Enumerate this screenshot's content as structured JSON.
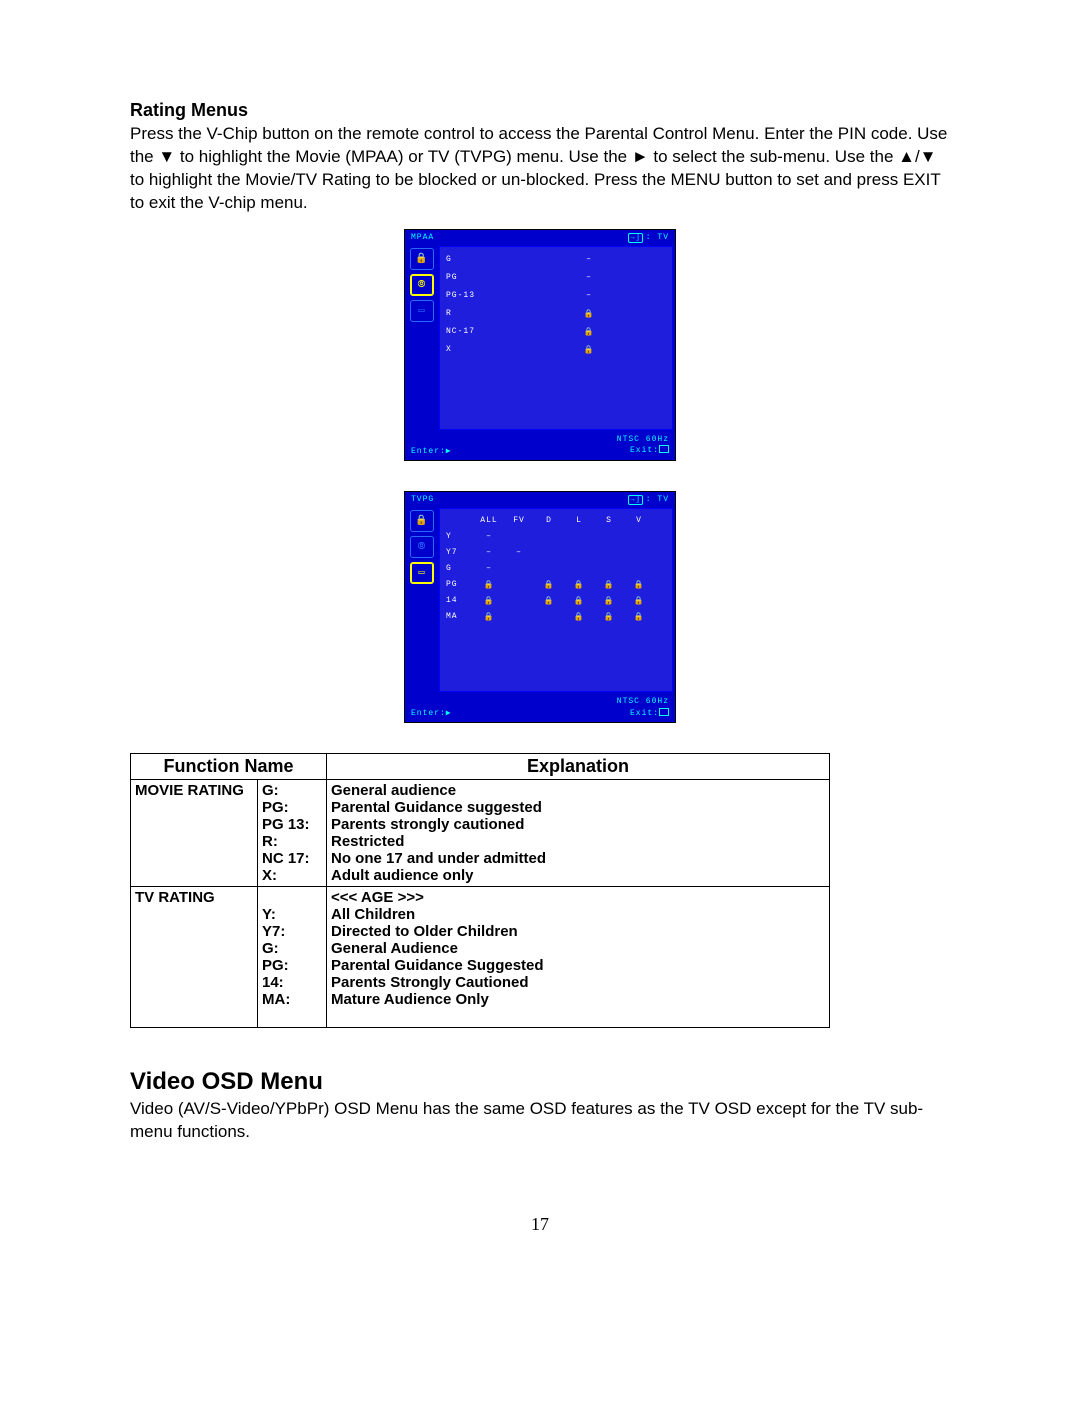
{
  "section1": {
    "title": "Rating Menus",
    "paragraph": "Press the V-Chip button on the remote control to access the Parental Control Menu. Enter the PIN code. Use the ▼ to highlight the Movie (MPAA) or TV (TVPG) menu. Use the ► to select the sub-menu. Use the ▲/▼ to highlight the Movie/TV Rating to be blocked or un-blocked. Press the MENU button to set and press EXIT to exit the V-chip menu."
  },
  "mpaa_osd": {
    "title": "MPAA",
    "tv_label": ": TV",
    "rows": [
      {
        "label": "G",
        "status": "–"
      },
      {
        "label": "PG",
        "status": "–"
      },
      {
        "label": "PG-13",
        "status": "–"
      },
      {
        "label": "R",
        "status": "lock"
      },
      {
        "label": "NC-17",
        "status": "lock"
      },
      {
        "label": "X",
        "status": "lock"
      }
    ],
    "enter": "Enter:▶",
    "signal": "NTSC 60Hz",
    "exit": "Exit:"
  },
  "tvpg_osd": {
    "title": "TVPG",
    "tv_label": ": TV",
    "cols": [
      "ALL",
      "FV",
      "D",
      "L",
      "S",
      "V"
    ],
    "rows": [
      {
        "label": "Y",
        "cells": [
          "–",
          "",
          "",
          "",
          "",
          ""
        ]
      },
      {
        "label": "Y7",
        "cells": [
          "–",
          "–",
          "",
          "",
          "",
          ""
        ]
      },
      {
        "label": "G",
        "cells": [
          "–",
          "",
          "",
          "",
          "",
          ""
        ]
      },
      {
        "label": "PG",
        "cells": [
          "lock",
          "",
          "lock",
          "lock",
          "lock",
          "lock"
        ]
      },
      {
        "label": "14",
        "cells": [
          "lock",
          "",
          "lock",
          "lock",
          "lock",
          "lock"
        ]
      },
      {
        "label": "MA",
        "cells": [
          "lock",
          "",
          "",
          "lock",
          "lock",
          "lock"
        ]
      }
    ],
    "enter": "Enter:▶",
    "signal": "NTSC 60Hz",
    "exit": "Exit:"
  },
  "table": {
    "header_func": "Function Name",
    "header_exp": "Explanation",
    "movie_label": "MOVIE RATING",
    "movie_rows": [
      {
        "code": "G:",
        "exp": "General audience"
      },
      {
        "code": "PG:",
        "exp": "Parental Guidance suggested"
      },
      {
        "code": "PG 13:",
        "exp": "Parents strongly cautioned"
      },
      {
        "code": "R:",
        "exp": "Restricted"
      },
      {
        "code": "NC 17:",
        "exp": "No one 17 and under admitted"
      },
      {
        "code": "X:",
        "exp": "Adult audience only"
      }
    ],
    "tv_label": "TV RATING",
    "tv_age_header": "<<< AGE >>>",
    "tv_rows": [
      {
        "code": "Y:",
        "exp": "All Children"
      },
      {
        "code": "Y7:",
        "exp": "Directed to Older Children"
      },
      {
        "code": "G:",
        "exp": "General Audience"
      },
      {
        "code": "PG:",
        "exp": "Parental Guidance Suggested"
      },
      {
        "code": "14:",
        "exp": "Parents Strongly Cautioned"
      },
      {
        "code": "MA:",
        "exp": "Mature Audience Only"
      }
    ]
  },
  "section2": {
    "title": "Video OSD Menu",
    "paragraph": "Video (AV/S-Video/YPbPr) OSD Menu has the same OSD features as the TV OSD except for the TV sub-menu functions."
  },
  "page_number": "17",
  "glyphs": {
    "lock": "🔒",
    "dash": "–"
  }
}
